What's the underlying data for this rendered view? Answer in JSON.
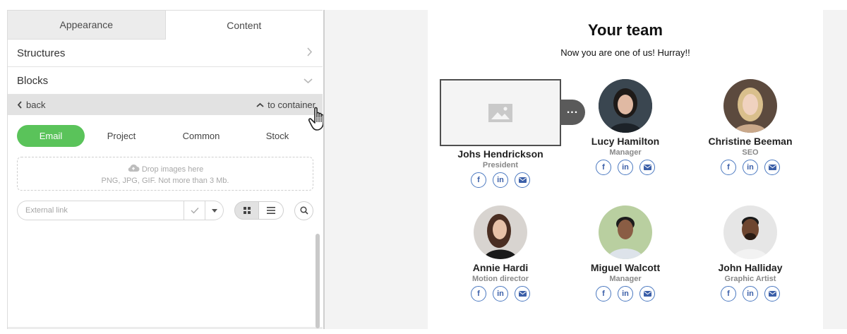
{
  "editor": {
    "tabs": [
      {
        "label": "Appearance"
      },
      {
        "label": "Content"
      }
    ],
    "sections": {
      "structures_label": "Structures",
      "blocks_label": "Blocks"
    },
    "nav": {
      "back_label": "back",
      "container_label": "to container"
    },
    "image_tabs": [
      {
        "label": "Email"
      },
      {
        "label": "Project"
      },
      {
        "label": "Common"
      },
      {
        "label": "Stock"
      }
    ],
    "dropzone": {
      "line1": "Drop images here",
      "line2": "PNG, JPG, GIF. Not more than 3 Mb."
    },
    "external_link": {
      "placeholder": "External link"
    },
    "accent_color": "#5ac35a"
  },
  "preview": {
    "title": "Your team",
    "subtitle": "Now you are one of us! Hurray!!",
    "members": [
      {
        "name": "Johs Hendrickson",
        "role": "President",
        "avatar": "image-placeholder-icon"
      },
      {
        "name": "Lucy Hamilton",
        "role": "Manager",
        "avatar": "woman-dark-hair-photo"
      },
      {
        "name": "Christine Beeman",
        "role": "SEO",
        "avatar": "woman-blonde-photo"
      },
      {
        "name": "Annie Hardi",
        "role": "Motion director",
        "avatar": "woman-long-hair-photo"
      },
      {
        "name": "Miguel Walcott",
        "role": "Manager",
        "avatar": "man-smiling-photo"
      },
      {
        "name": "John Halliday",
        "role": "Graphic Artist",
        "avatar": "man-beard-photo"
      }
    ],
    "social_icons": [
      "facebook-icon",
      "linkedin-icon",
      "email-icon"
    ],
    "social_color": "#3b5fa8"
  }
}
